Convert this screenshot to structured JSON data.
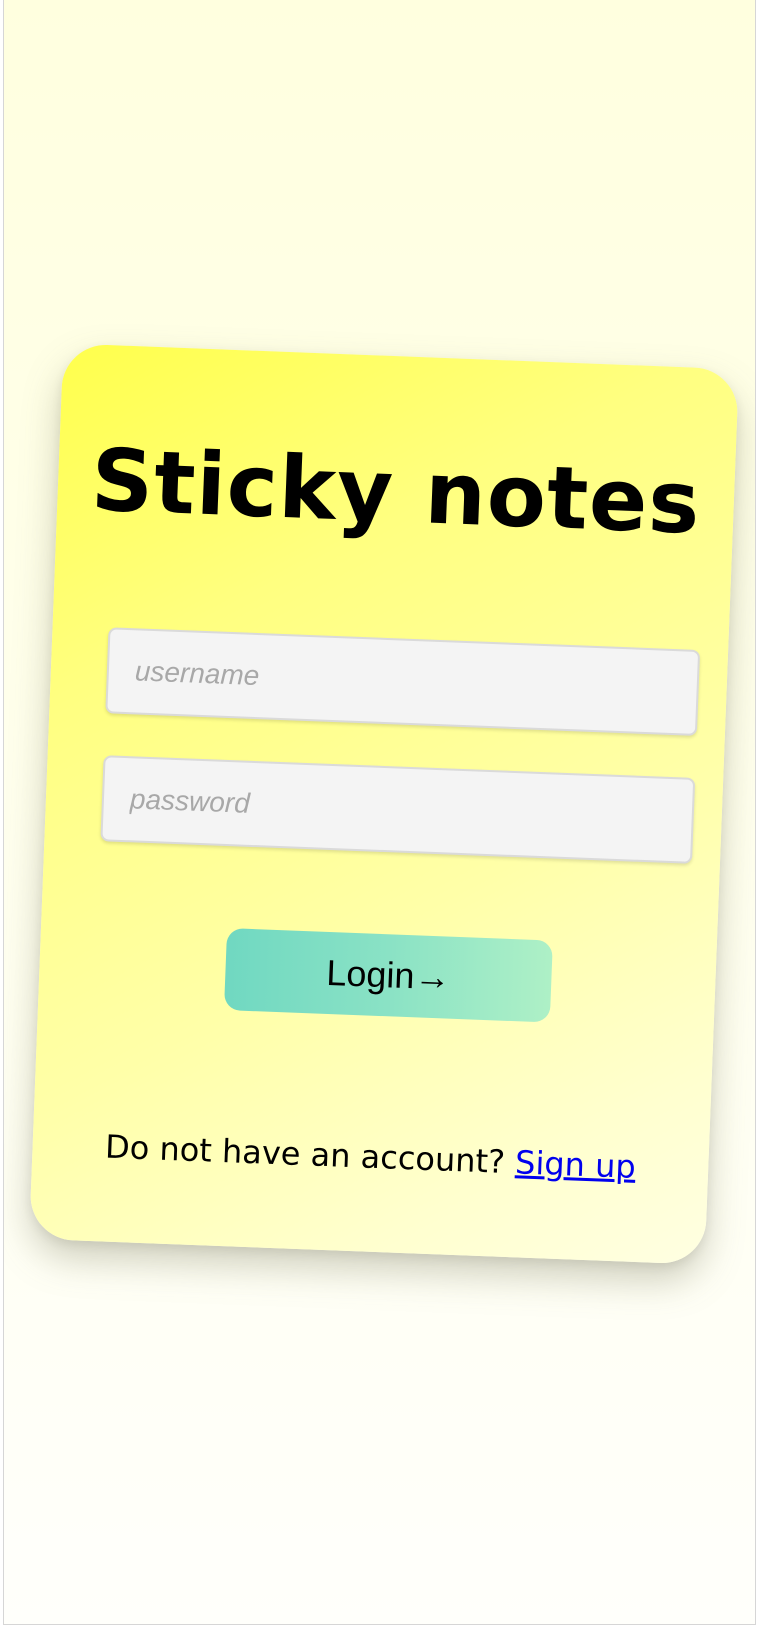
{
  "app": {
    "title": "Sticky notes"
  },
  "form": {
    "username": {
      "value": "",
      "placeholder": "username"
    },
    "password": {
      "value": "",
      "placeholder": "password"
    },
    "login_label": "Login→"
  },
  "footer": {
    "prompt": "Do not have an account? ",
    "signup_label": "Sign up"
  },
  "colors": {
    "page_background": "#ffffe6",
    "card_top": "#ffff4c",
    "card_bottom": "#ffffe2",
    "button_start": "#70d8c1",
    "button_end": "#aef0c6",
    "link": "#0000ee"
  }
}
